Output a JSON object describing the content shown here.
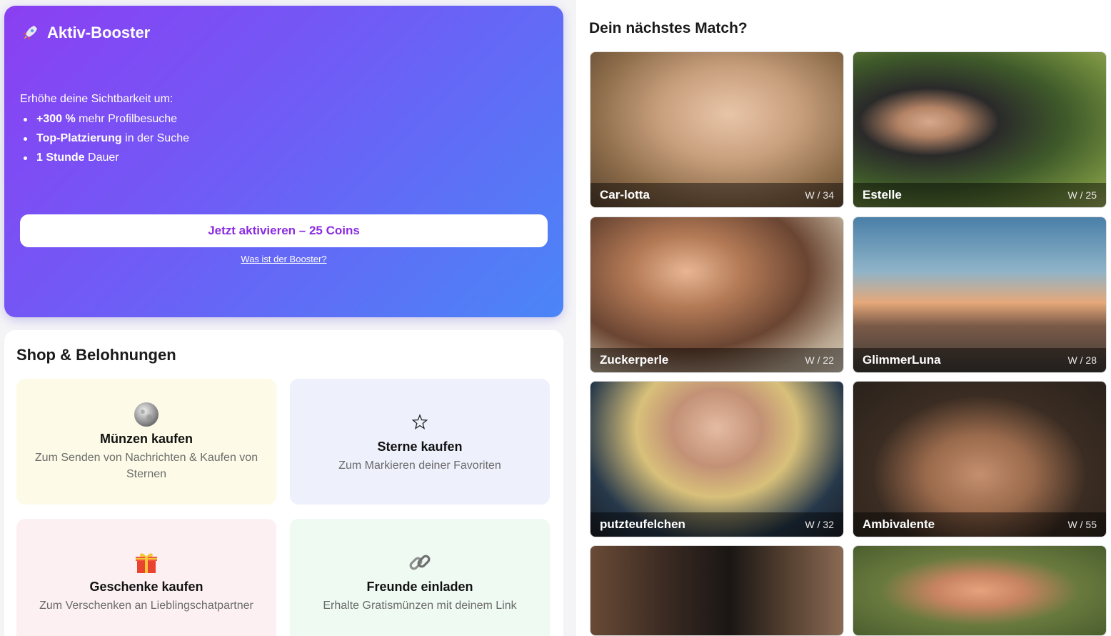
{
  "booster": {
    "title": "Aktiv-Booster",
    "intro": "Erhöhe deine Sichtbarkeit um:",
    "benefits": [
      {
        "bold": "+300 %",
        "rest": " mehr Profilbesuche"
      },
      {
        "bold": "Top-Platzierung",
        "rest": " in der Suche"
      },
      {
        "bold": "1 Stunde",
        "rest": " Dauer"
      }
    ],
    "button_label": "Jetzt aktivieren – 25 Coins",
    "help_link": "Was ist der Booster?",
    "icon": "rocket-icon"
  },
  "shop": {
    "title": "Shop & Belohnungen",
    "tiles": [
      {
        "title": "Münzen kaufen",
        "subtitle": "Zum Senden von Nachrichten & Kaufen von Sternen",
        "icon": "coin-icon"
      },
      {
        "title": "Sterne kaufen",
        "subtitle": "Zum Markieren deiner Favoriten",
        "icon": "star-icon"
      },
      {
        "title": "Geschenke kaufen",
        "subtitle": "Zum Verschenken an Lieblingschatpartner",
        "icon": "gift-icon"
      },
      {
        "title": "Freunde einladen",
        "subtitle": "Erhalte Gratismünzen mit deinem Link",
        "icon": "link-icon"
      }
    ]
  },
  "match": {
    "title": "Dein nächstes Match?",
    "profiles": [
      {
        "name": "Car-lotta",
        "meta": "W / 34"
      },
      {
        "name": "Estelle",
        "meta": "W / 25"
      },
      {
        "name": "Zuckerperle",
        "meta": "W / 22"
      },
      {
        "name": "GlimmerLuna",
        "meta": "W / 28"
      },
      {
        "name": "putzteufelchen",
        "meta": "W / 32"
      },
      {
        "name": "Ambivalente",
        "meta": "W / 55"
      },
      {
        "name": "",
        "meta": ""
      },
      {
        "name": "",
        "meta": ""
      }
    ]
  },
  "colors": {
    "gradient_start": "#8b3ff2",
    "gradient_end": "#4a86f7",
    "button_text": "#8a2be2",
    "coins_tile": "#fdfbe7",
    "stars_tile": "#eef0fc",
    "gifts_tile": "#fcf0f3",
    "friends_tile": "#eefaf2"
  }
}
